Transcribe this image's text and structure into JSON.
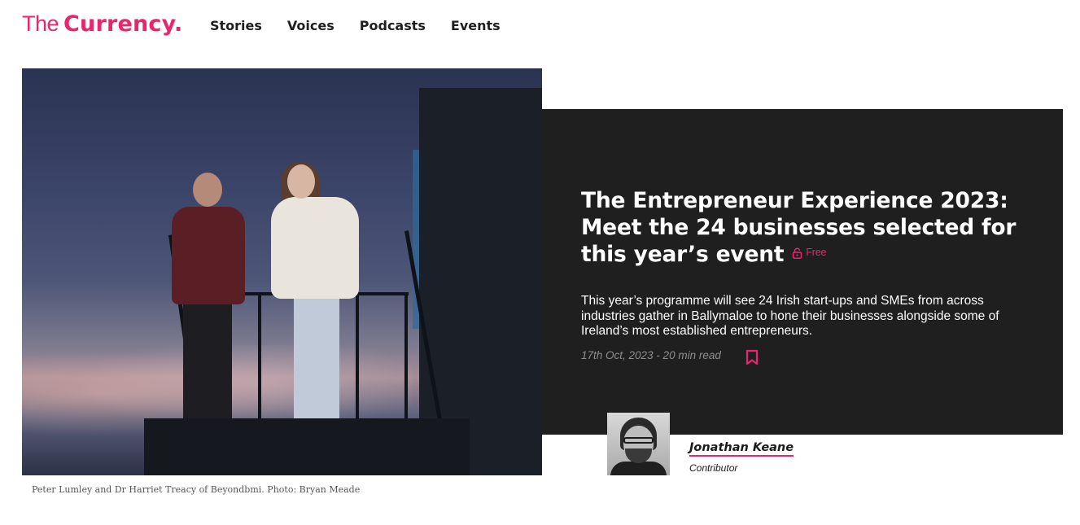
{
  "header": {
    "logo_prefix": "The",
    "logo_name": "Currency.",
    "nav": [
      "Stories",
      "Voices",
      "Podcasts",
      "Events"
    ]
  },
  "hero": {
    "caption": "Peter Lumley and Dr Harriet Treacy of Beyondbmi. Photo: Bryan Meade"
  },
  "article": {
    "headline": "The Entrepreneur Experience 2023: Meet the 24 businesses selected for this year’s event",
    "access_badge": "Free",
    "standfirst": "This year’s programme will see 24 Irish start-ups and SMEs from across industries gather in Ballymaloe to hone their businesses alongside some of Ireland’s most established entrepreneurs.",
    "meta": "17th Oct, 2023 - 20 min read"
  },
  "author": {
    "name": "Jonathan Keane",
    "role": "Contributor"
  },
  "colors": {
    "accent": "#e8266f",
    "panel": "#1f1f1f",
    "meta_text": "#8f8f8f"
  }
}
